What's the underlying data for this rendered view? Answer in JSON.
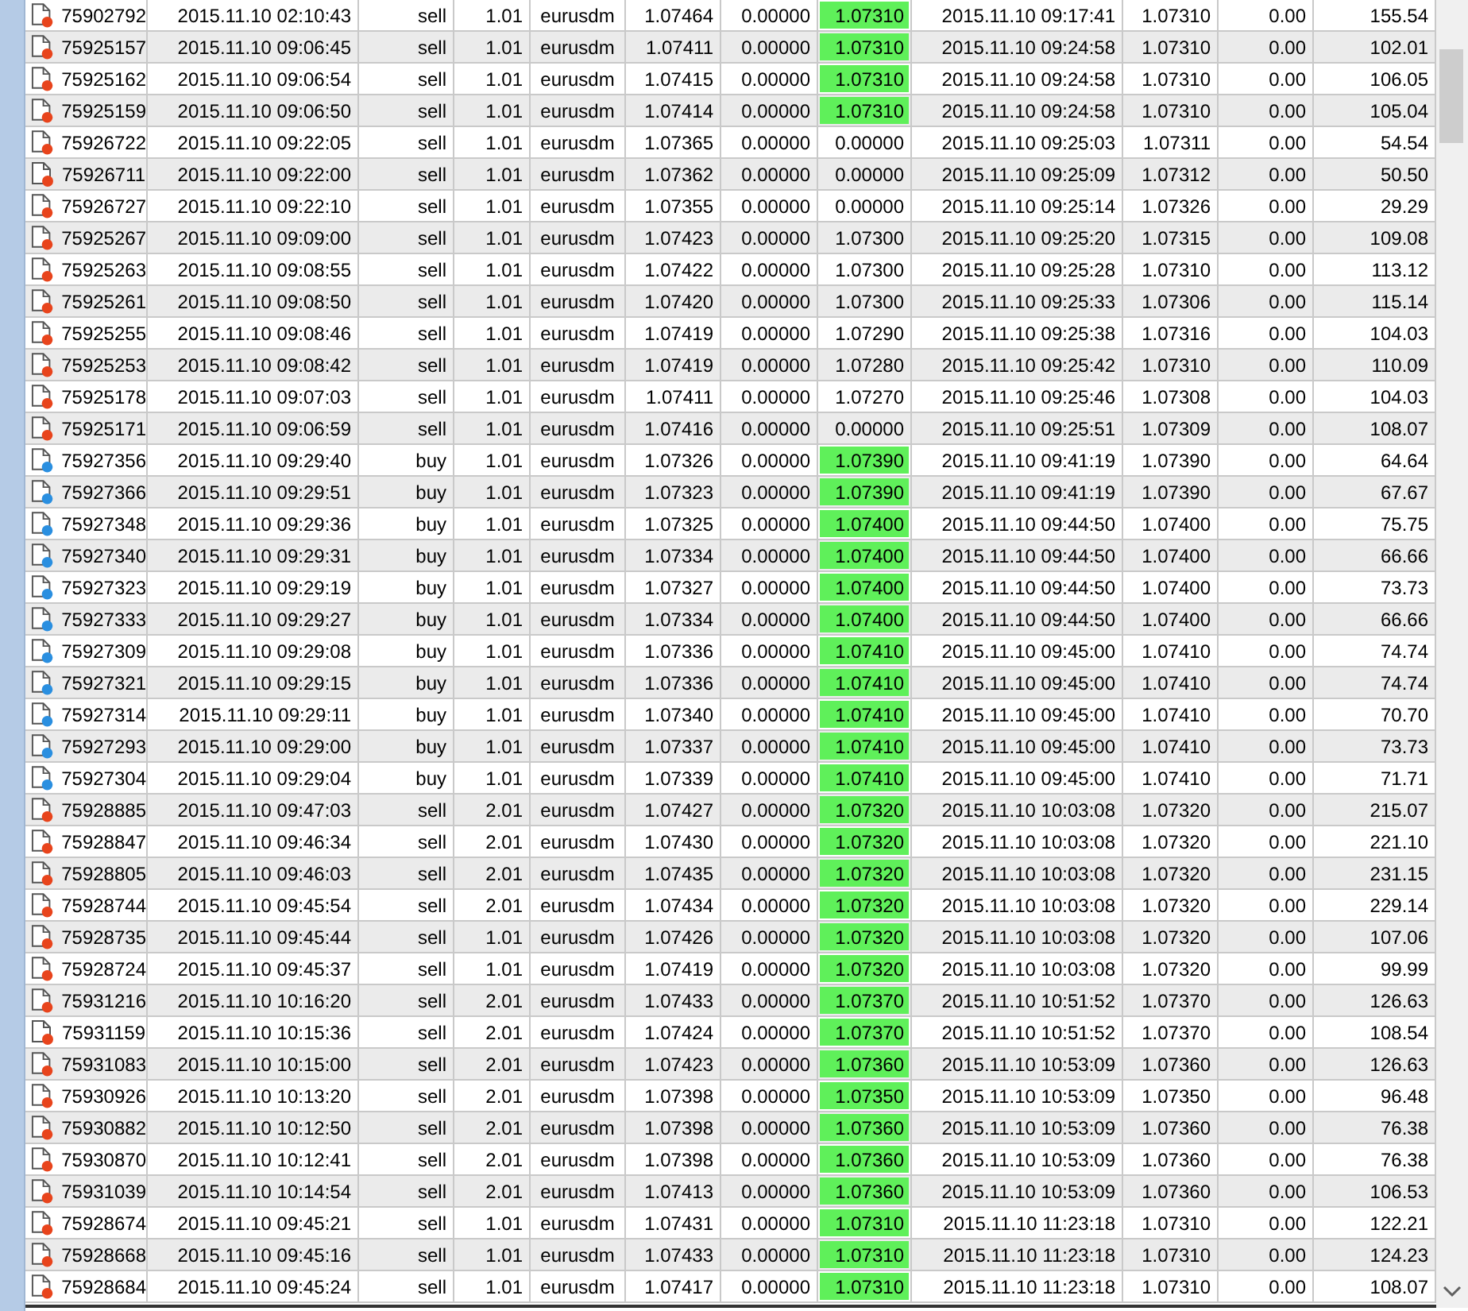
{
  "rows": [
    {
      "ticket": "75902792",
      "open_time": "2015.11.10 02:10:43",
      "type": "sell",
      "size": "1.01",
      "symbol": "eurusdm",
      "price": "1.07464",
      "sl": "0.00000",
      "tp": "1.07310",
      "tp_highlight": true,
      "close_time": "2015.11.10 09:17:41",
      "close_price": "1.07310",
      "commission": "0.00",
      "profit": "155.54",
      "color": "#e8441c"
    },
    {
      "ticket": "75925157",
      "open_time": "2015.11.10 09:06:45",
      "type": "sell",
      "size": "1.01",
      "symbol": "eurusdm",
      "price": "1.07411",
      "sl": "0.00000",
      "tp": "1.07310",
      "tp_highlight": true,
      "close_time": "2015.11.10 09:24:58",
      "close_price": "1.07310",
      "commission": "0.00",
      "profit": "102.01",
      "color": "#e8441c"
    },
    {
      "ticket": "75925162",
      "open_time": "2015.11.10 09:06:54",
      "type": "sell",
      "size": "1.01",
      "symbol": "eurusdm",
      "price": "1.07415",
      "sl": "0.00000",
      "tp": "1.07310",
      "tp_highlight": true,
      "close_time": "2015.11.10 09:24:58",
      "close_price": "1.07310",
      "commission": "0.00",
      "profit": "106.05",
      "color": "#e8441c"
    },
    {
      "ticket": "75925159",
      "open_time": "2015.11.10 09:06:50",
      "type": "sell",
      "size": "1.01",
      "symbol": "eurusdm",
      "price": "1.07414",
      "sl": "0.00000",
      "tp": "1.07310",
      "tp_highlight": true,
      "close_time": "2015.11.10 09:24:58",
      "close_price": "1.07310",
      "commission": "0.00",
      "profit": "105.04",
      "color": "#e8441c"
    },
    {
      "ticket": "75926722",
      "open_time": "2015.11.10 09:22:05",
      "type": "sell",
      "size": "1.01",
      "symbol": "eurusdm",
      "price": "1.07365",
      "sl": "0.00000",
      "tp": "0.00000",
      "tp_highlight": false,
      "close_time": "2015.11.10 09:25:03",
      "close_price": "1.07311",
      "commission": "0.00",
      "profit": "54.54",
      "color": "#e8441c"
    },
    {
      "ticket": "75926711",
      "open_time": "2015.11.10 09:22:00",
      "type": "sell",
      "size": "1.01",
      "symbol": "eurusdm",
      "price": "1.07362",
      "sl": "0.00000",
      "tp": "0.00000",
      "tp_highlight": false,
      "close_time": "2015.11.10 09:25:09",
      "close_price": "1.07312",
      "commission": "0.00",
      "profit": "50.50",
      "color": "#e8441c"
    },
    {
      "ticket": "75926727",
      "open_time": "2015.11.10 09:22:10",
      "type": "sell",
      "size": "1.01",
      "symbol": "eurusdm",
      "price": "1.07355",
      "sl": "0.00000",
      "tp": "0.00000",
      "tp_highlight": false,
      "close_time": "2015.11.10 09:25:14",
      "close_price": "1.07326",
      "commission": "0.00",
      "profit": "29.29",
      "color": "#e8441c"
    },
    {
      "ticket": "75925267",
      "open_time": "2015.11.10 09:09:00",
      "type": "sell",
      "size": "1.01",
      "symbol": "eurusdm",
      "price": "1.07423",
      "sl": "0.00000",
      "tp": "1.07300",
      "tp_highlight": false,
      "close_time": "2015.11.10 09:25:20",
      "close_price": "1.07315",
      "commission": "0.00",
      "profit": "109.08",
      "color": "#e8441c"
    },
    {
      "ticket": "75925263",
      "open_time": "2015.11.10 09:08:55",
      "type": "sell",
      "size": "1.01",
      "symbol": "eurusdm",
      "price": "1.07422",
      "sl": "0.00000",
      "tp": "1.07300",
      "tp_highlight": false,
      "close_time": "2015.11.10 09:25:28",
      "close_price": "1.07310",
      "commission": "0.00",
      "profit": "113.12",
      "color": "#e8441c"
    },
    {
      "ticket": "75925261",
      "open_time": "2015.11.10 09:08:50",
      "type": "sell",
      "size": "1.01",
      "symbol": "eurusdm",
      "price": "1.07420",
      "sl": "0.00000",
      "tp": "1.07300",
      "tp_highlight": false,
      "close_time": "2015.11.10 09:25:33",
      "close_price": "1.07306",
      "commission": "0.00",
      "profit": "115.14",
      "color": "#e8441c"
    },
    {
      "ticket": "75925255",
      "open_time": "2015.11.10 09:08:46",
      "type": "sell",
      "size": "1.01",
      "symbol": "eurusdm",
      "price": "1.07419",
      "sl": "0.00000",
      "tp": "1.07290",
      "tp_highlight": false,
      "close_time": "2015.11.10 09:25:38",
      "close_price": "1.07316",
      "commission": "0.00",
      "profit": "104.03",
      "color": "#e8441c"
    },
    {
      "ticket": "75925253",
      "open_time": "2015.11.10 09:08:42",
      "type": "sell",
      "size": "1.01",
      "symbol": "eurusdm",
      "price": "1.07419",
      "sl": "0.00000",
      "tp": "1.07280",
      "tp_highlight": false,
      "close_time": "2015.11.10 09:25:42",
      "close_price": "1.07310",
      "commission": "0.00",
      "profit": "110.09",
      "color": "#e8441c"
    },
    {
      "ticket": "75925178",
      "open_time": "2015.11.10 09:07:03",
      "type": "sell",
      "size": "1.01",
      "symbol": "eurusdm",
      "price": "1.07411",
      "sl": "0.00000",
      "tp": "1.07270",
      "tp_highlight": false,
      "close_time": "2015.11.10 09:25:46",
      "close_price": "1.07308",
      "commission": "0.00",
      "profit": "104.03",
      "color": "#e8441c"
    },
    {
      "ticket": "75925171",
      "open_time": "2015.11.10 09:06:59",
      "type": "sell",
      "size": "1.01",
      "symbol": "eurusdm",
      "price": "1.07416",
      "sl": "0.00000",
      "tp": "0.00000",
      "tp_highlight": false,
      "close_time": "2015.11.10 09:25:51",
      "close_price": "1.07309",
      "commission": "0.00",
      "profit": "108.07",
      "color": "#e8441c"
    },
    {
      "ticket": "75927356",
      "open_time": "2015.11.10 09:29:40",
      "type": "buy",
      "size": "1.01",
      "symbol": "eurusdm",
      "price": "1.07326",
      "sl": "0.00000",
      "tp": "1.07390",
      "tp_highlight": true,
      "close_time": "2015.11.10 09:41:19",
      "close_price": "1.07390",
      "commission": "0.00",
      "profit": "64.64",
      "color": "#2a8fe0"
    },
    {
      "ticket": "75927366",
      "open_time": "2015.11.10 09:29:51",
      "type": "buy",
      "size": "1.01",
      "symbol": "eurusdm",
      "price": "1.07323",
      "sl": "0.00000",
      "tp": "1.07390",
      "tp_highlight": true,
      "close_time": "2015.11.10 09:41:19",
      "close_price": "1.07390",
      "commission": "0.00",
      "profit": "67.67",
      "color": "#2a8fe0"
    },
    {
      "ticket": "75927348",
      "open_time": "2015.11.10 09:29:36",
      "type": "buy",
      "size": "1.01",
      "symbol": "eurusdm",
      "price": "1.07325",
      "sl": "0.00000",
      "tp": "1.07400",
      "tp_highlight": true,
      "close_time": "2015.11.10 09:44:50",
      "close_price": "1.07400",
      "commission": "0.00",
      "profit": "75.75",
      "color": "#2a8fe0"
    },
    {
      "ticket": "75927340",
      "open_time": "2015.11.10 09:29:31",
      "type": "buy",
      "size": "1.01",
      "symbol": "eurusdm",
      "price": "1.07334",
      "sl": "0.00000",
      "tp": "1.07400",
      "tp_highlight": true,
      "close_time": "2015.11.10 09:44:50",
      "close_price": "1.07400",
      "commission": "0.00",
      "profit": "66.66",
      "color": "#2a8fe0"
    },
    {
      "ticket": "75927323",
      "open_time": "2015.11.10 09:29:19",
      "type": "buy",
      "size": "1.01",
      "symbol": "eurusdm",
      "price": "1.07327",
      "sl": "0.00000",
      "tp": "1.07400",
      "tp_highlight": true,
      "close_time": "2015.11.10 09:44:50",
      "close_price": "1.07400",
      "commission": "0.00",
      "profit": "73.73",
      "color": "#2a8fe0"
    },
    {
      "ticket": "75927333",
      "open_time": "2015.11.10 09:29:27",
      "type": "buy",
      "size": "1.01",
      "symbol": "eurusdm",
      "price": "1.07334",
      "sl": "0.00000",
      "tp": "1.07400",
      "tp_highlight": true,
      "close_time": "2015.11.10 09:44:50",
      "close_price": "1.07400",
      "commission": "0.00",
      "profit": "66.66",
      "color": "#2a8fe0"
    },
    {
      "ticket": "75927309",
      "open_time": "2015.11.10 09:29:08",
      "type": "buy",
      "size": "1.01",
      "symbol": "eurusdm",
      "price": "1.07336",
      "sl": "0.00000",
      "tp": "1.07410",
      "tp_highlight": true,
      "close_time": "2015.11.10 09:45:00",
      "close_price": "1.07410",
      "commission": "0.00",
      "profit": "74.74",
      "color": "#2a8fe0"
    },
    {
      "ticket": "75927321",
      "open_time": "2015.11.10 09:29:15",
      "type": "buy",
      "size": "1.01",
      "symbol": "eurusdm",
      "price": "1.07336",
      "sl": "0.00000",
      "tp": "1.07410",
      "tp_highlight": true,
      "close_time": "2015.11.10 09:45:00",
      "close_price": "1.07410",
      "commission": "0.00",
      "profit": "74.74",
      "color": "#2a8fe0"
    },
    {
      "ticket": "75927314",
      "open_time": "2015.11.10 09:29:11",
      "type": "buy",
      "size": "1.01",
      "symbol": "eurusdm",
      "price": "1.07340",
      "sl": "0.00000",
      "tp": "1.07410",
      "tp_highlight": true,
      "close_time": "2015.11.10 09:45:00",
      "close_price": "1.07410",
      "commission": "0.00",
      "profit": "70.70",
      "color": "#2a8fe0"
    },
    {
      "ticket": "75927293",
      "open_time": "2015.11.10 09:29:00",
      "type": "buy",
      "size": "1.01",
      "symbol": "eurusdm",
      "price": "1.07337",
      "sl": "0.00000",
      "tp": "1.07410",
      "tp_highlight": true,
      "close_time": "2015.11.10 09:45:00",
      "close_price": "1.07410",
      "commission": "0.00",
      "profit": "73.73",
      "color": "#2a8fe0"
    },
    {
      "ticket": "75927304",
      "open_time": "2015.11.10 09:29:04",
      "type": "buy",
      "size": "1.01",
      "symbol": "eurusdm",
      "price": "1.07339",
      "sl": "0.00000",
      "tp": "1.07410",
      "tp_highlight": true,
      "close_time": "2015.11.10 09:45:00",
      "close_price": "1.07410",
      "commission": "0.00",
      "profit": "71.71",
      "color": "#2a8fe0"
    },
    {
      "ticket": "75928885",
      "open_time": "2015.11.10 09:47:03",
      "type": "sell",
      "size": "2.01",
      "symbol": "eurusdm",
      "price": "1.07427",
      "sl": "0.00000",
      "tp": "1.07320",
      "tp_highlight": true,
      "close_time": "2015.11.10 10:03:08",
      "close_price": "1.07320",
      "commission": "0.00",
      "profit": "215.07",
      "color": "#e8441c"
    },
    {
      "ticket": "75928847",
      "open_time": "2015.11.10 09:46:34",
      "type": "sell",
      "size": "2.01",
      "symbol": "eurusdm",
      "price": "1.07430",
      "sl": "0.00000",
      "tp": "1.07320",
      "tp_highlight": true,
      "close_time": "2015.11.10 10:03:08",
      "close_price": "1.07320",
      "commission": "0.00",
      "profit": "221.10",
      "color": "#e8441c"
    },
    {
      "ticket": "75928805",
      "open_time": "2015.11.10 09:46:03",
      "type": "sell",
      "size": "2.01",
      "symbol": "eurusdm",
      "price": "1.07435",
      "sl": "0.00000",
      "tp": "1.07320",
      "tp_highlight": true,
      "close_time": "2015.11.10 10:03:08",
      "close_price": "1.07320",
      "commission": "0.00",
      "profit": "231.15",
      "color": "#e8441c"
    },
    {
      "ticket": "75928744",
      "open_time": "2015.11.10 09:45:54",
      "type": "sell",
      "size": "2.01",
      "symbol": "eurusdm",
      "price": "1.07434",
      "sl": "0.00000",
      "tp": "1.07320",
      "tp_highlight": true,
      "close_time": "2015.11.10 10:03:08",
      "close_price": "1.07320",
      "commission": "0.00",
      "profit": "229.14",
      "color": "#e8441c"
    },
    {
      "ticket": "75928735",
      "open_time": "2015.11.10 09:45:44",
      "type": "sell",
      "size": "1.01",
      "symbol": "eurusdm",
      "price": "1.07426",
      "sl": "0.00000",
      "tp": "1.07320",
      "tp_highlight": true,
      "close_time": "2015.11.10 10:03:08",
      "close_price": "1.07320",
      "commission": "0.00",
      "profit": "107.06",
      "color": "#e8441c"
    },
    {
      "ticket": "75928724",
      "open_time": "2015.11.10 09:45:37",
      "type": "sell",
      "size": "1.01",
      "symbol": "eurusdm",
      "price": "1.07419",
      "sl": "0.00000",
      "tp": "1.07320",
      "tp_highlight": true,
      "close_time": "2015.11.10 10:03:08",
      "close_price": "1.07320",
      "commission": "0.00",
      "profit": "99.99",
      "color": "#e8441c"
    },
    {
      "ticket": "75931216",
      "open_time": "2015.11.10 10:16:20",
      "type": "sell",
      "size": "2.01",
      "symbol": "eurusdm",
      "price": "1.07433",
      "sl": "0.00000",
      "tp": "1.07370",
      "tp_highlight": true,
      "close_time": "2015.11.10 10:51:52",
      "close_price": "1.07370",
      "commission": "0.00",
      "profit": "126.63",
      "color": "#e8441c"
    },
    {
      "ticket": "75931159",
      "open_time": "2015.11.10 10:15:36",
      "type": "sell",
      "size": "2.01",
      "symbol": "eurusdm",
      "price": "1.07424",
      "sl": "0.00000",
      "tp": "1.07370",
      "tp_highlight": true,
      "close_time": "2015.11.10 10:51:52",
      "close_price": "1.07370",
      "commission": "0.00",
      "profit": "108.54",
      "color": "#e8441c"
    },
    {
      "ticket": "75931083",
      "open_time": "2015.11.10 10:15:00",
      "type": "sell",
      "size": "2.01",
      "symbol": "eurusdm",
      "price": "1.07423",
      "sl": "0.00000",
      "tp": "1.07360",
      "tp_highlight": true,
      "close_time": "2015.11.10 10:53:09",
      "close_price": "1.07360",
      "commission": "0.00",
      "profit": "126.63",
      "color": "#e8441c"
    },
    {
      "ticket": "75930926",
      "open_time": "2015.11.10 10:13:20",
      "type": "sell",
      "size": "2.01",
      "symbol": "eurusdm",
      "price": "1.07398",
      "sl": "0.00000",
      "tp": "1.07350",
      "tp_highlight": true,
      "close_time": "2015.11.10 10:53:09",
      "close_price": "1.07350",
      "commission": "0.00",
      "profit": "96.48",
      "color": "#e8441c"
    },
    {
      "ticket": "75930882",
      "open_time": "2015.11.10 10:12:50",
      "type": "sell",
      "size": "2.01",
      "symbol": "eurusdm",
      "price": "1.07398",
      "sl": "0.00000",
      "tp": "1.07360",
      "tp_highlight": true,
      "close_time": "2015.11.10 10:53:09",
      "close_price": "1.07360",
      "commission": "0.00",
      "profit": "76.38",
      "color": "#e8441c"
    },
    {
      "ticket": "75930870",
      "open_time": "2015.11.10 10:12:41",
      "type": "sell",
      "size": "2.01",
      "symbol": "eurusdm",
      "price": "1.07398",
      "sl": "0.00000",
      "tp": "1.07360",
      "tp_highlight": true,
      "close_time": "2015.11.10 10:53:09",
      "close_price": "1.07360",
      "commission": "0.00",
      "profit": "76.38",
      "color": "#e8441c"
    },
    {
      "ticket": "75931039",
      "open_time": "2015.11.10 10:14:54",
      "type": "sell",
      "size": "2.01",
      "symbol": "eurusdm",
      "price": "1.07413",
      "sl": "0.00000",
      "tp": "1.07360",
      "tp_highlight": true,
      "close_time": "2015.11.10 10:53:09",
      "close_price": "1.07360",
      "commission": "0.00",
      "profit": "106.53",
      "color": "#e8441c"
    },
    {
      "ticket": "75928674",
      "open_time": "2015.11.10 09:45:21",
      "type": "sell",
      "size": "1.01",
      "symbol": "eurusdm",
      "price": "1.07431",
      "sl": "0.00000",
      "tp": "1.07310",
      "tp_highlight": true,
      "close_time": "2015.11.10 11:23:18",
      "close_price": "1.07310",
      "commission": "0.00",
      "profit": "122.21",
      "color": "#e8441c"
    },
    {
      "ticket": "75928668",
      "open_time": "2015.11.10 09:45:16",
      "type": "sell",
      "size": "1.01",
      "symbol": "eurusdm",
      "price": "1.07433",
      "sl": "0.00000",
      "tp": "1.07310",
      "tp_highlight": true,
      "close_time": "2015.11.10 11:23:18",
      "close_price": "1.07310",
      "commission": "0.00",
      "profit": "124.23",
      "color": "#e8441c"
    },
    {
      "ticket": "75928684",
      "open_time": "2015.11.10 09:45:24",
      "type": "sell",
      "size": "1.01",
      "symbol": "eurusdm",
      "price": "1.07417",
      "sl": "0.00000",
      "tp": "1.07310",
      "tp_highlight": true,
      "close_time": "2015.11.10 11:23:18",
      "close_price": "1.07310",
      "commission": "0.00",
      "profit": "108.07",
      "color": "#e8441c"
    }
  ]
}
